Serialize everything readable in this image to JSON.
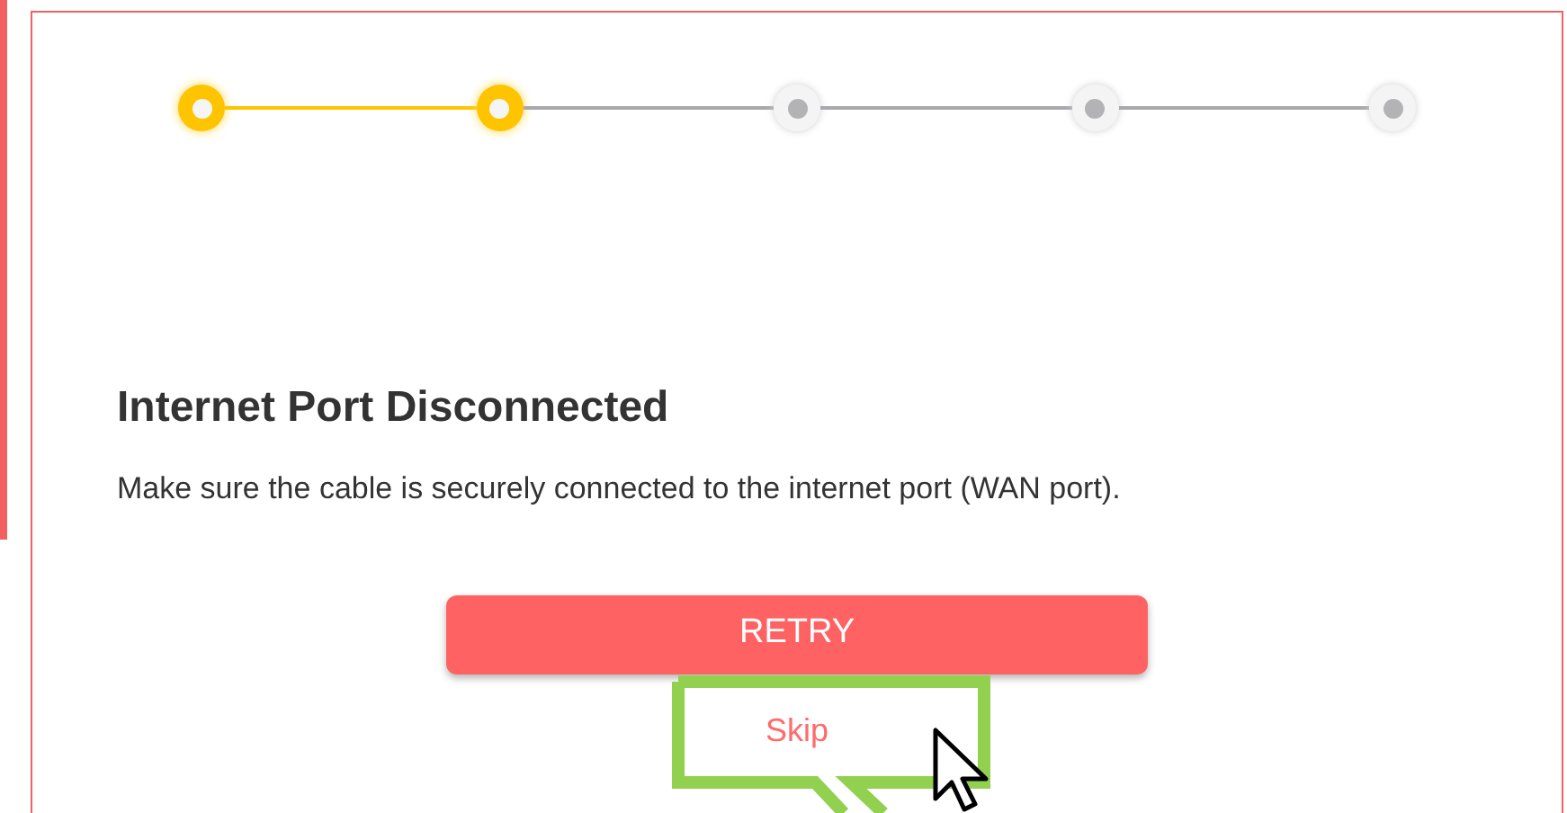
{
  "steps": [
    {
      "completed": true
    },
    {
      "completed": true
    },
    {
      "completed": false
    },
    {
      "completed": false
    },
    {
      "completed": false
    }
  ],
  "title": "Internet Port Disconnected",
  "message": "Make sure the cable is securely connected to the internet port (WAN port).",
  "primary_button": "RETRY",
  "skip_link": "Skip"
}
